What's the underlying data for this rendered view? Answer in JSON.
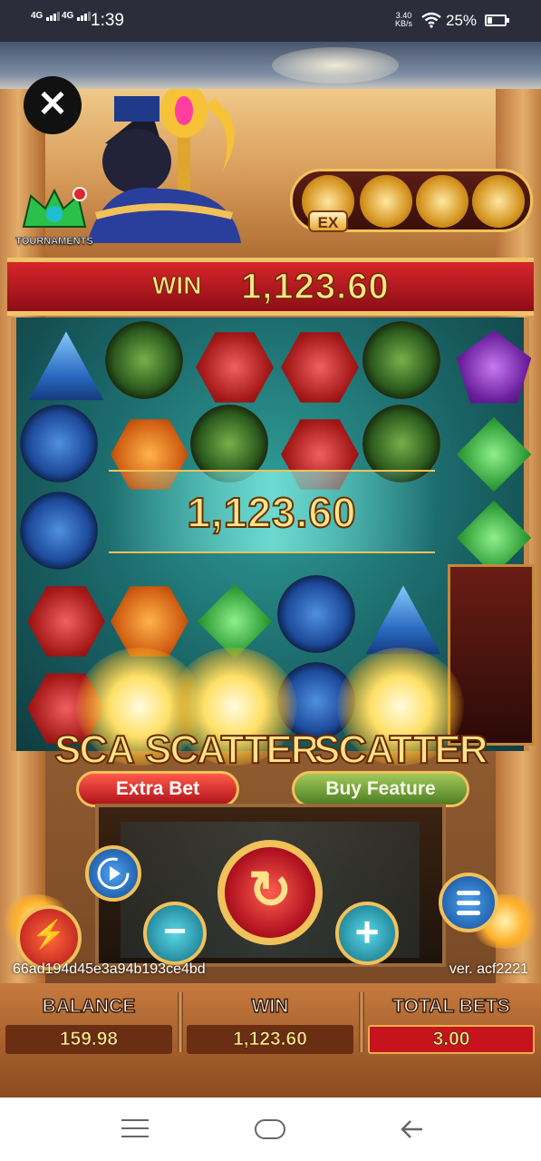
{
  "status_bar": {
    "signal1": "4G",
    "signal2": "4G",
    "time": "1:39",
    "net_speed_value": "3.40",
    "net_speed_unit": "KB/s",
    "battery_percent": "25%"
  },
  "game": {
    "tournaments_label": "TOURNAMENTS",
    "ex_label": "EX",
    "win_label": "WIN",
    "win_amount": "1,123.60",
    "big_win_amount": "1,123.60",
    "scatter_texts": [
      "SCA",
      "SCATTER",
      "SCATTER"
    ],
    "extra_bet_label": "Extra Bet",
    "buy_feature_label": "Buy Feature",
    "game_id": "66ad194d45e3a94b193ce4bd",
    "version": "ver. acf2221",
    "stats": {
      "balance": {
        "label": "BALANCE",
        "value": "159.98"
      },
      "win": {
        "label": "WIN",
        "value": "1,123.60"
      },
      "total_bets": {
        "label": "TOTAL BETS",
        "value": "3.00"
      }
    },
    "buttons": {
      "close": "✕",
      "minus": "−",
      "plus": "+",
      "spin": "↻",
      "turbo": "⚡"
    }
  }
}
